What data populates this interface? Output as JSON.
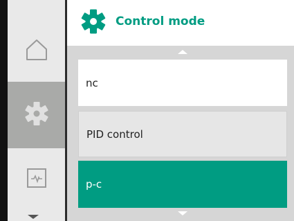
{
  "header": {
    "title": "Control mode",
    "icon": "gear-icon",
    "accent_color": "#009c82"
  },
  "sidebar": {
    "items": [
      {
        "icon": "home-icon",
        "selected": false
      },
      {
        "icon": "gear-icon",
        "selected": true
      },
      {
        "icon": "diagnostics-icon",
        "selected": false
      }
    ]
  },
  "menu": {
    "options": [
      {
        "label": "nc",
        "selected": false
      },
      {
        "label": "PID control",
        "selected": false
      },
      {
        "label": "p-c",
        "selected": true
      }
    ]
  }
}
